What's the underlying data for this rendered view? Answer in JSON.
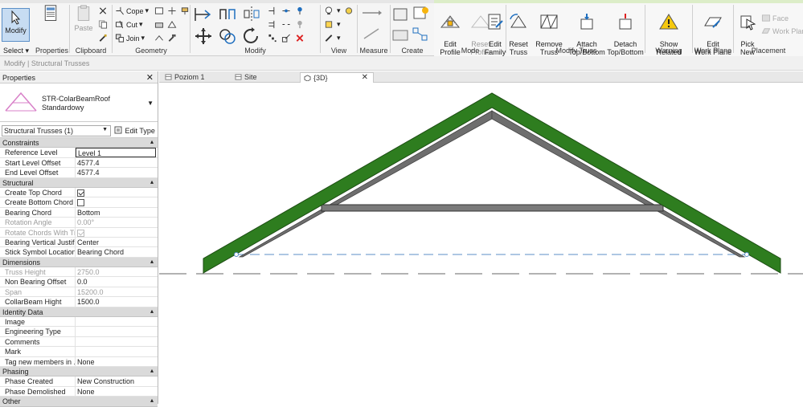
{
  "ribbon": {
    "modify_label": "Modify",
    "select_label": "Select",
    "properties_label": "Properties",
    "paste_label": "Paste",
    "clipboard_label": "Clipboard",
    "cope_label": "Cope",
    "cut_label": "Cut",
    "join_label": "Join",
    "geometry_label": "Geometry",
    "modify_panel_label": "Modify",
    "view_label": "View",
    "measure_label": "Measure",
    "create_label": "Create",
    "mode_panel_label": "Mode",
    "modify_truss_panel_label": "Modify Truss",
    "warning_panel_label": "Warning",
    "work_plane_panel_label": "Work Plane",
    "placement_panel_label": "Placement",
    "edit_profile": "Edit\nProfile",
    "reset_profile": "Reset\nProfile",
    "edit_family": "Edit\nFamily",
    "reset_truss": "Reset\nTruss",
    "remove_truss_family": "Remove\nTruss Family",
    "attach_top_bottom": "Attach\nTop/Bottom",
    "detach_top_bottom": "Detach\nTop/Bottom",
    "show_related_warnings": "Show Related\nWarnings",
    "edit_work_plane": "Edit\nWork Plane",
    "pick_new": "Pick\nNew",
    "face_label": "Face",
    "work_plane_label": "Work Plane"
  },
  "status_bar": {
    "text": "Modify | Structural Trusses"
  },
  "properties": {
    "title": "Properties",
    "type_family": "STR-ColarBeamRoof",
    "type_name": "Standardowy",
    "filter_value": "Structural Trusses (1)",
    "edit_type_label": "Edit Type",
    "groups": [
      {
        "name": "Constraints",
        "rows": [
          {
            "label": "Reference Level",
            "value": "Level 1",
            "editing": true
          },
          {
            "label": "Start Level Offset",
            "value": "4577.4"
          },
          {
            "label": "End Level Offset",
            "value": "4577.4"
          }
        ]
      },
      {
        "name": "Structural",
        "rows": [
          {
            "label": "Create Top Chord",
            "check": true
          },
          {
            "label": "Create Bottom Chord",
            "check": false
          },
          {
            "label": "Bearing Chord",
            "value": "Bottom"
          },
          {
            "label": "Rotation Angle",
            "value": "0.00°",
            "disabled": true
          },
          {
            "label": "Rotate Chords With Tr...",
            "check": true,
            "disabled": true
          },
          {
            "label": "Bearing Vertical Justifi...",
            "value": "Center"
          },
          {
            "label": "Stick Symbol Location",
            "value": "Bearing Chord"
          }
        ]
      },
      {
        "name": "Dimensions",
        "rows": [
          {
            "label": "Truss Height",
            "value": "2750.0",
            "disabled": true
          },
          {
            "label": "Non Bearing Offset",
            "value": "0.0"
          },
          {
            "label": "Span",
            "value": "15200.0",
            "disabled": true
          },
          {
            "label": "CollarBeam Hight",
            "value": "1500.0"
          }
        ]
      },
      {
        "name": "Identity Data",
        "rows": [
          {
            "label": "Image",
            "value": ""
          },
          {
            "label": "Engineering Type",
            "value": ""
          },
          {
            "label": "Comments",
            "value": ""
          },
          {
            "label": "Mark",
            "value": ""
          },
          {
            "label": "Tag new members in ...",
            "value": "None"
          }
        ]
      },
      {
        "name": "Phasing",
        "rows": [
          {
            "label": "Phase Created",
            "value": "New Construction"
          },
          {
            "label": "Phase Demolished",
            "value": "None"
          }
        ]
      },
      {
        "name": "Other",
        "rows": []
      }
    ]
  },
  "tabs": [
    {
      "label": "Poziom 1",
      "icon": "floor-plan-icon"
    },
    {
      "label": "Site",
      "icon": "site-plan-icon"
    },
    {
      "label": "{3D}",
      "icon": "3d-view-icon",
      "active": true
    }
  ],
  "colors": {
    "ribbon_bg": "#f5f5f5",
    "context_tab": "#dcedc8",
    "active_button": "#c7dcf2",
    "truss_green": "#2e7d1f",
    "truss_gray": "#7a7a7a",
    "group_header": "#dadada"
  }
}
